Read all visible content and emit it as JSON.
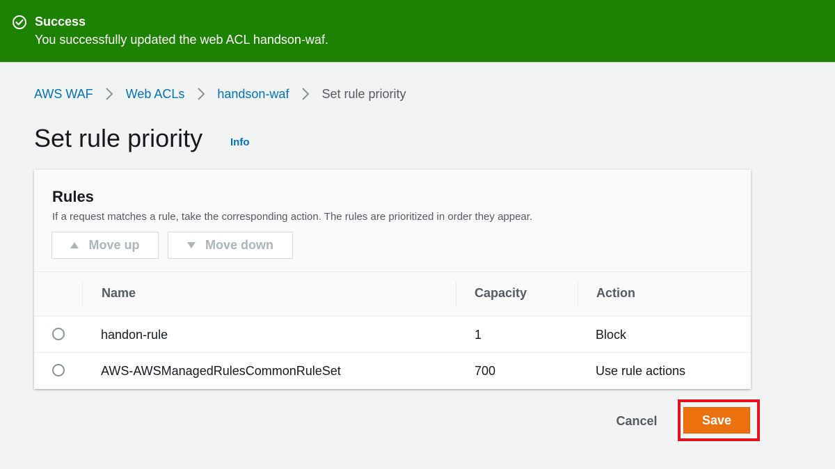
{
  "flash": {
    "title": "Success",
    "message": "You successfully updated the web ACL handson-waf."
  },
  "breadcrumb": {
    "items": [
      "AWS WAF",
      "Web ACLs",
      "handson-waf"
    ],
    "current": "Set rule priority"
  },
  "page": {
    "title": "Set rule priority",
    "info_label": "Info"
  },
  "rules": {
    "title": "Rules",
    "description": "If a request matches a rule, take the corresponding action. The rules are prioritized in order they appear.",
    "move_up_label": "Move up",
    "move_down_label": "Move down",
    "columns": [
      "Name",
      "Capacity",
      "Action"
    ],
    "rows": [
      {
        "name": "handon-rule",
        "capacity": "1",
        "action": "Block"
      },
      {
        "name": "AWS-AWSManagedRulesCommonRuleSet",
        "capacity": "700",
        "action": "Use rule actions"
      }
    ]
  },
  "footer": {
    "cancel_label": "Cancel",
    "save_label": "Save"
  },
  "colors": {
    "success": "#1d8102",
    "link": "#0073bb",
    "primary_button": "#ec7211",
    "highlight": "#e8101a"
  }
}
